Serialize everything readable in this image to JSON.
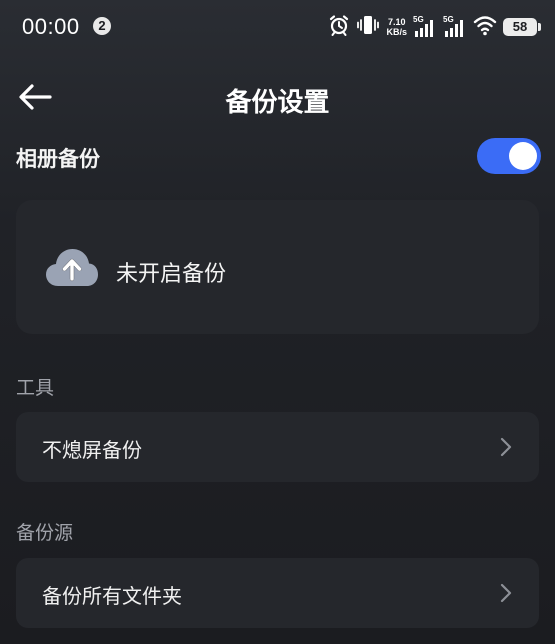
{
  "status_bar": {
    "time": "00:00",
    "notification_count": "2",
    "net_speed_value": "7.10",
    "net_speed_unit": "KB/s",
    "signal_1_label": "5G",
    "signal_2_label": "5G",
    "battery": "58"
  },
  "header": {
    "title": "备份设置",
    "back_icon": "arrow-left-icon"
  },
  "album_backup": {
    "label": "相册备份",
    "enabled": true,
    "accent_color": "#3b6cf6"
  },
  "backup_status": {
    "icon": "cloud-upload-icon",
    "text": "未开启备份"
  },
  "sections": [
    {
      "title": "工具",
      "items": [
        {
          "label": "不熄屏备份",
          "icon": "chevron-right-icon"
        }
      ]
    },
    {
      "title": "备份源",
      "items": [
        {
          "label": "备份所有文件夹",
          "icon": "chevron-right-icon"
        }
      ]
    }
  ]
}
